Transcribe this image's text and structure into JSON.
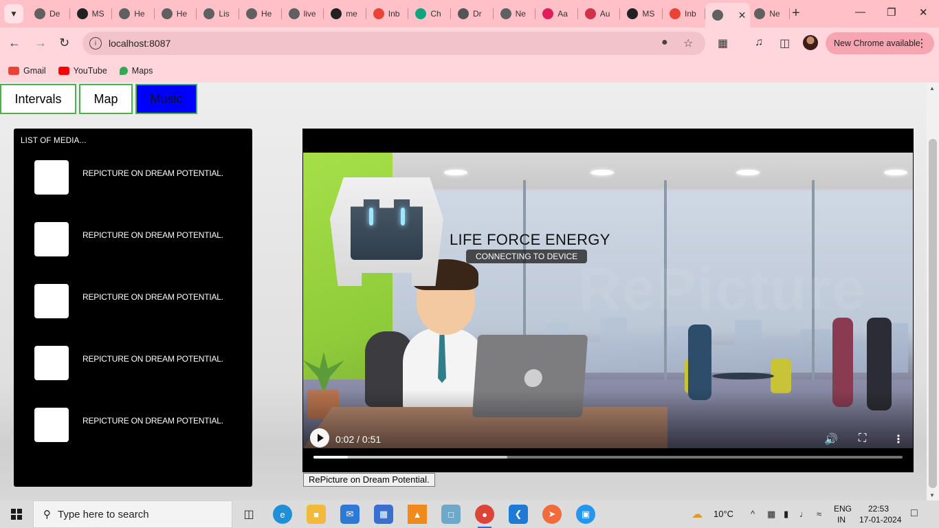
{
  "browser": {
    "tabs": [
      {
        "label": "De",
        "icon": "globe-icon",
        "color": "#606060"
      },
      {
        "label": "MS",
        "icon": "github-icon",
        "color": "#222222"
      },
      {
        "label": "He",
        "icon": "globe-icon",
        "color": "#606060"
      },
      {
        "label": "He",
        "icon": "globe-icon",
        "color": "#606060"
      },
      {
        "label": "Lis",
        "icon": "globe-icon",
        "color": "#606060"
      },
      {
        "label": "He",
        "icon": "globe-icon",
        "color": "#606060"
      },
      {
        "label": "live",
        "icon": "globe-icon",
        "color": "#606060"
      },
      {
        "label": "me",
        "icon": "github-icon",
        "color": "#222222"
      },
      {
        "label": "Inb",
        "icon": "gmail-icon",
        "color": "#ea4335"
      },
      {
        "label": "Ch",
        "icon": "chatgpt-icon",
        "color": "#10a37f"
      },
      {
        "label": "Dr",
        "icon": "folder-icon",
        "color": "#555555"
      },
      {
        "label": "Ne",
        "icon": "globe-icon",
        "color": "#606060"
      },
      {
        "label": "Aa",
        "icon": "slack-icon",
        "color": "#e01e5a"
      },
      {
        "label": "Au",
        "icon": "auth-icon",
        "color": "#d1314a"
      },
      {
        "label": "MS",
        "icon": "github-icon",
        "color": "#222222"
      },
      {
        "label": "Inb",
        "icon": "gmail-icon",
        "color": "#ea4335"
      },
      {
        "label": "",
        "icon": "globe-icon",
        "color": "#606060",
        "active": true
      },
      {
        "label": "Ne",
        "icon": "globe-icon",
        "color": "#606060"
      }
    ],
    "url": "localhost:8087",
    "update_label": "New Chrome available",
    "bookmarks": [
      {
        "label": "Gmail",
        "color": "#ea4335"
      },
      {
        "label": "YouTube",
        "color": "#ff0000"
      },
      {
        "label": "Maps",
        "color": "#34a853"
      }
    ]
  },
  "app": {
    "nav": [
      {
        "label": "Intervals",
        "active": false
      },
      {
        "label": "Map",
        "active": false
      },
      {
        "label": "Music",
        "active": true
      }
    ],
    "media_list": {
      "title": "LIST OF MEDIA...",
      "items": [
        "REPICTURE ON DREAM POTENTIAL.",
        "REPICTURE ON DREAM POTENTIAL.",
        "REPICTURE ON DREAM POTENTIAL.",
        "REPICTURE ON DREAM POTENTIAL.",
        "REPICTURE ON DREAM POTENTIAL."
      ]
    },
    "overlay": {
      "title": "LIFE FORCE ENERGY",
      "status": "CONNECTING TO DEVICE"
    },
    "player": {
      "time": "0:02 / 0:51",
      "played_fraction": 0.058,
      "buffered_fraction": 0.329,
      "watermark": "RePicture"
    },
    "caption": "RePicture on Dream Potential."
  },
  "taskbar": {
    "search_placeholder": "Type here to search",
    "weather": "10°C",
    "lang_top": "ENG",
    "lang_bottom": "IN",
    "time": "22:53",
    "date": "17-01-2024"
  },
  "colors": {
    "active_nav": "#0000ff",
    "nav_border": "#4caf50",
    "browser_chrome": "#ffc0c8"
  }
}
